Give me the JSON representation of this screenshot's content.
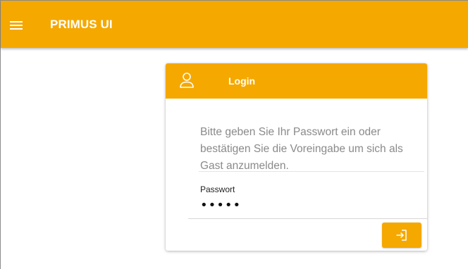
{
  "app": {
    "title": "PRIMUS UI",
    "accent_color": "#f5a800",
    "menu_icon": "hamburger-menu-icon"
  },
  "login_card": {
    "title": "Login",
    "header_icon": "user-icon",
    "message": "Bitte geben Sie Ihr Passwort ein oder bestätigen Sie die Voreingabe um sich als Gast anzumelden.",
    "password": {
      "label": "Passwort",
      "value": "•••••"
    },
    "submit_button": {
      "icon": "login-enter-icon"
    }
  }
}
